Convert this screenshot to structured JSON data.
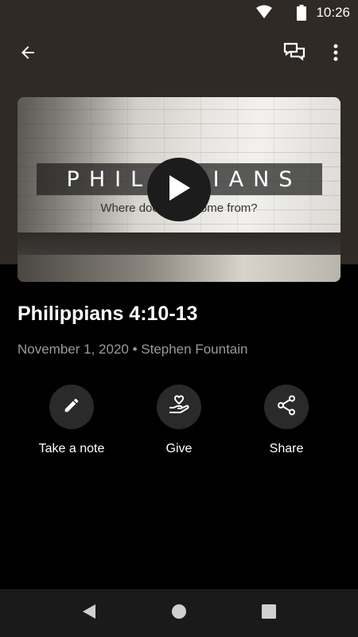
{
  "status_bar": {
    "time": "10:26",
    "icons": [
      "wifi-icon",
      "battery-icon"
    ]
  },
  "app_bar": {
    "back_icon": "arrow-left-icon",
    "chat_icon": "chat-bubbles-icon",
    "more_icon": "more-vertical-icon"
  },
  "video": {
    "title_text": "PHILIPPIANS",
    "tagline": "Where does JOY come from?",
    "play_icon": "play-icon"
  },
  "sermon": {
    "title": "Philippians 4:10-13",
    "meta": "November 1, 2020 • Stephen Fountain"
  },
  "actions": [
    {
      "label": "Take a note",
      "icon": "pencil-icon"
    },
    {
      "label": "Give",
      "icon": "heart-hand-icon"
    },
    {
      "label": "Share",
      "icon": "share-icon"
    }
  ],
  "nav_bar": {
    "icons": [
      "back-triangle-icon",
      "home-circle-icon",
      "recents-square-icon"
    ]
  },
  "colors": {
    "hero_background": "#2f2a26",
    "page_background": "#000000",
    "action_circle": "#2a2a2a",
    "meta_text": "#9a9a9a",
    "nav_bar": "#1a1a1a"
  }
}
